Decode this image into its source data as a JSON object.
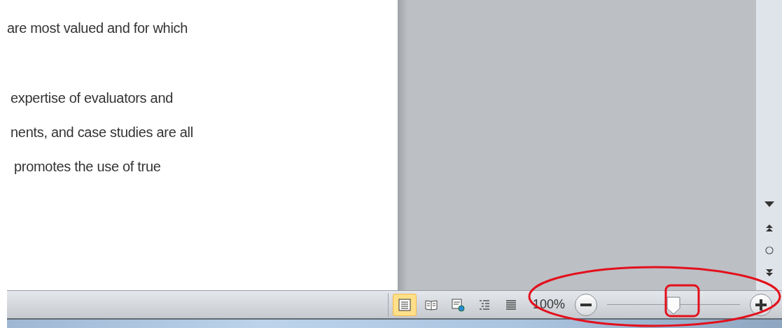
{
  "document": {
    "paragraphs": [
      [
        "are most valued and for which"
      ],
      [
        "expertise of evaluators and",
        "nents, and case studies are all",
        "promotes the use of true"
      ]
    ]
  },
  "scrollbar": {
    "buttons": [
      {
        "kind": "down"
      },
      {
        "kind": "prev"
      },
      {
        "kind": "browse"
      },
      {
        "kind": "next"
      }
    ]
  },
  "status_bar": {
    "view_buttons": [
      {
        "kind": "print",
        "selected": true
      },
      {
        "kind": "reading",
        "selected": false
      },
      {
        "kind": "web",
        "selected": false
      },
      {
        "kind": "outline",
        "selected": false
      },
      {
        "kind": "draft",
        "selected": false
      }
    ],
    "zoom": {
      "percent": "100%",
      "level": 0.5
    }
  },
  "annotations": [
    {
      "kind": "ellipse"
    },
    {
      "kind": "rect"
    }
  ]
}
